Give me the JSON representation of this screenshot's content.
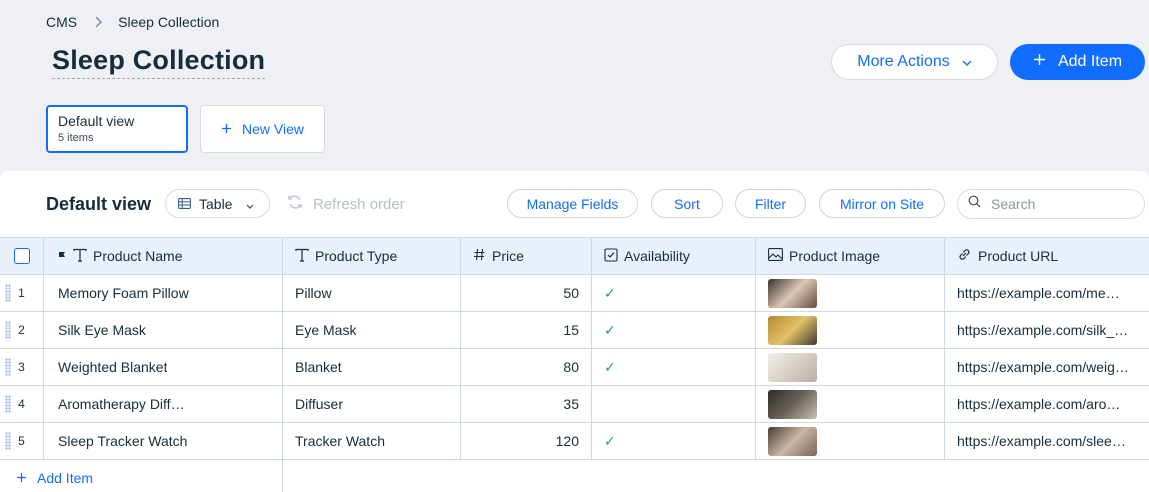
{
  "breadcrumb": {
    "root": "CMS",
    "current": "Sleep Collection"
  },
  "page": {
    "title": "Sleep Collection"
  },
  "actions": {
    "more": "More Actions",
    "add_item": "Add Item"
  },
  "views": {
    "default": {
      "name": "Default view",
      "count": "5 items"
    },
    "new": "New View"
  },
  "toolbar": {
    "title": "Default view",
    "view_type": "Table",
    "refresh": "Refresh order",
    "manage_fields": "Manage Fields",
    "sort": "Sort",
    "filter": "Filter",
    "mirror": "Mirror on Site",
    "search_placeholder": "Search"
  },
  "table": {
    "columns": [
      {
        "label": "Product Name",
        "icon": "text-type-icon"
      },
      {
        "label": "Product Type",
        "icon": "text-type-icon"
      },
      {
        "label": "Price",
        "icon": "number-icon"
      },
      {
        "label": "Availability",
        "icon": "boolean-icon"
      },
      {
        "label": "Product Image",
        "icon": "image-icon"
      },
      {
        "label": "Product URL",
        "icon": "link-icon"
      }
    ],
    "rows": [
      {
        "num": "1",
        "name": "Memory Foam Pillow",
        "type": "Pillow",
        "price": "50",
        "available": "✓",
        "url": "https://example.com/me…",
        "thumb_colors": [
          "#3a2f2a",
          "#d9c7b5",
          "#6b4a3a"
        ]
      },
      {
        "num": "2",
        "name": "Silk Eye Mask",
        "type": "Eye Mask",
        "price": "15",
        "available": "✓",
        "url": "https://example.com/silk_…",
        "thumb_colors": [
          "#b58a2e",
          "#e2c16a",
          "#3f3a33"
        ]
      },
      {
        "num": "3",
        "name": "Weighted Blanket",
        "type": "Blanket",
        "price": "80",
        "available": "✓",
        "url": "https://example.com/weig…",
        "thumb_colors": [
          "#f1ede8",
          "#d8d1c8",
          "#b9aea2"
        ]
      },
      {
        "num": "4",
        "name": "Aromatherapy Diff…",
        "type": "Diffuser",
        "price": "35",
        "available": "",
        "url": "https://example.com/aro…",
        "thumb_colors": [
          "#2d2a28",
          "#6a6258",
          "#c7bfb4"
        ]
      },
      {
        "num": "5",
        "name": "Sleep Tracker Watch",
        "type": "Tracker Watch",
        "price": "120",
        "available": "✓",
        "url": "https://example.com/slee…",
        "thumb_colors": [
          "#4a3a33",
          "#c9b6a3",
          "#7a6558"
        ]
      }
    ],
    "add_item": "Add Item"
  },
  "colors": {
    "accent": "#116dff",
    "check": "#2e9c63",
    "header_bg": "#e8f0fc",
    "page_bg": "#eef0f5"
  }
}
